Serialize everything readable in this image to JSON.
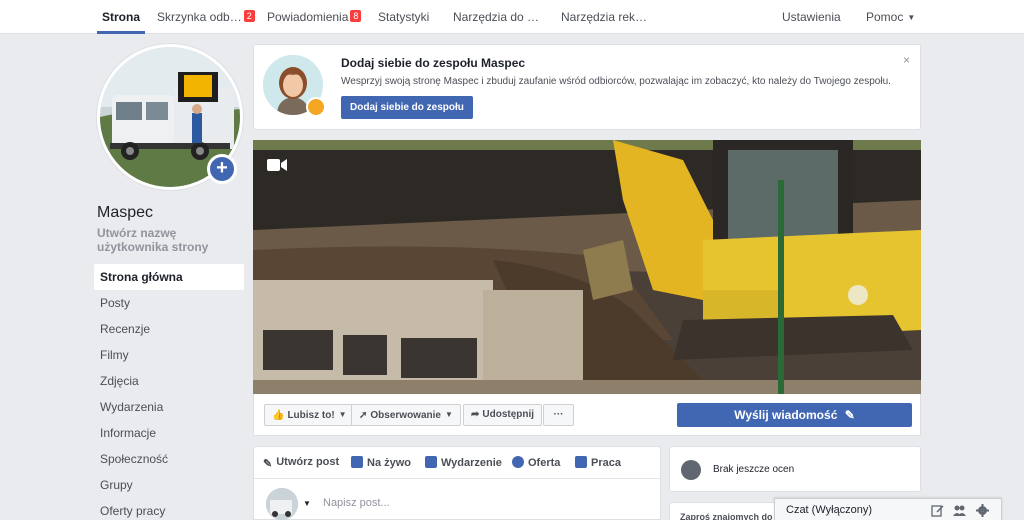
{
  "topnav": {
    "tabs": [
      {
        "label": "Strona",
        "active": true
      },
      {
        "label": "Skrzynka odb…",
        "badge": "2"
      },
      {
        "label": "Powiadomienia",
        "badge": "8"
      },
      {
        "label": "Statystyki"
      },
      {
        "label": "Narzędzia do …"
      },
      {
        "label": "Narzędzia rek…"
      }
    ],
    "settings": "Ustawienia",
    "help": "Pomoc"
  },
  "page": {
    "name": "Maspec",
    "create_username": "Utwórz nazwę użytkownika strony"
  },
  "leftnav": {
    "items": [
      {
        "label": "Strona główna",
        "active": true
      },
      {
        "label": "Posty"
      },
      {
        "label": "Recenzje"
      },
      {
        "label": "Filmy"
      },
      {
        "label": "Zdjęcia"
      },
      {
        "label": "Wydarzenia"
      },
      {
        "label": "Informacje"
      },
      {
        "label": "Społeczność"
      },
      {
        "label": "Grupy"
      },
      {
        "label": "Oferty pracy"
      }
    ]
  },
  "team_card": {
    "title": "Dodaj siebie do zespołu Maspec",
    "description": "Wesprzyj swoją stronę Maspec i zbuduj zaufanie wśród odbiorców, pozwalając im zobaczyć, kto należy do Twojego zespołu.",
    "button": "Dodaj siebie do zespołu",
    "close": "×"
  },
  "actions": {
    "like": "Lubisz to!",
    "follow": "Obserwowanie",
    "share": "Udostępnij",
    "more": "···",
    "send_message": "Wyślij wiadomość"
  },
  "composer": {
    "tabs": [
      {
        "label": "Utwórz post",
        "icon": "pencil-icon"
      },
      {
        "label": "Na żywo",
        "icon": "video-icon"
      },
      {
        "label": "Wydarzenie",
        "icon": "calendar-icon"
      },
      {
        "label": "Oferta",
        "icon": "offer-icon"
      },
      {
        "label": "Praca",
        "icon": "briefcase-icon"
      }
    ],
    "placeholder": "Napisz post..."
  },
  "reviews": {
    "text": "Brak jeszcze ocen"
  },
  "invite": {
    "text": "Zaproś znajomych do"
  },
  "chat": {
    "label": "Czat (Wyłączony)"
  },
  "colors": {
    "brand": "#4267b2",
    "badge": "#fa3e3e",
    "background": "#e9ebee"
  }
}
